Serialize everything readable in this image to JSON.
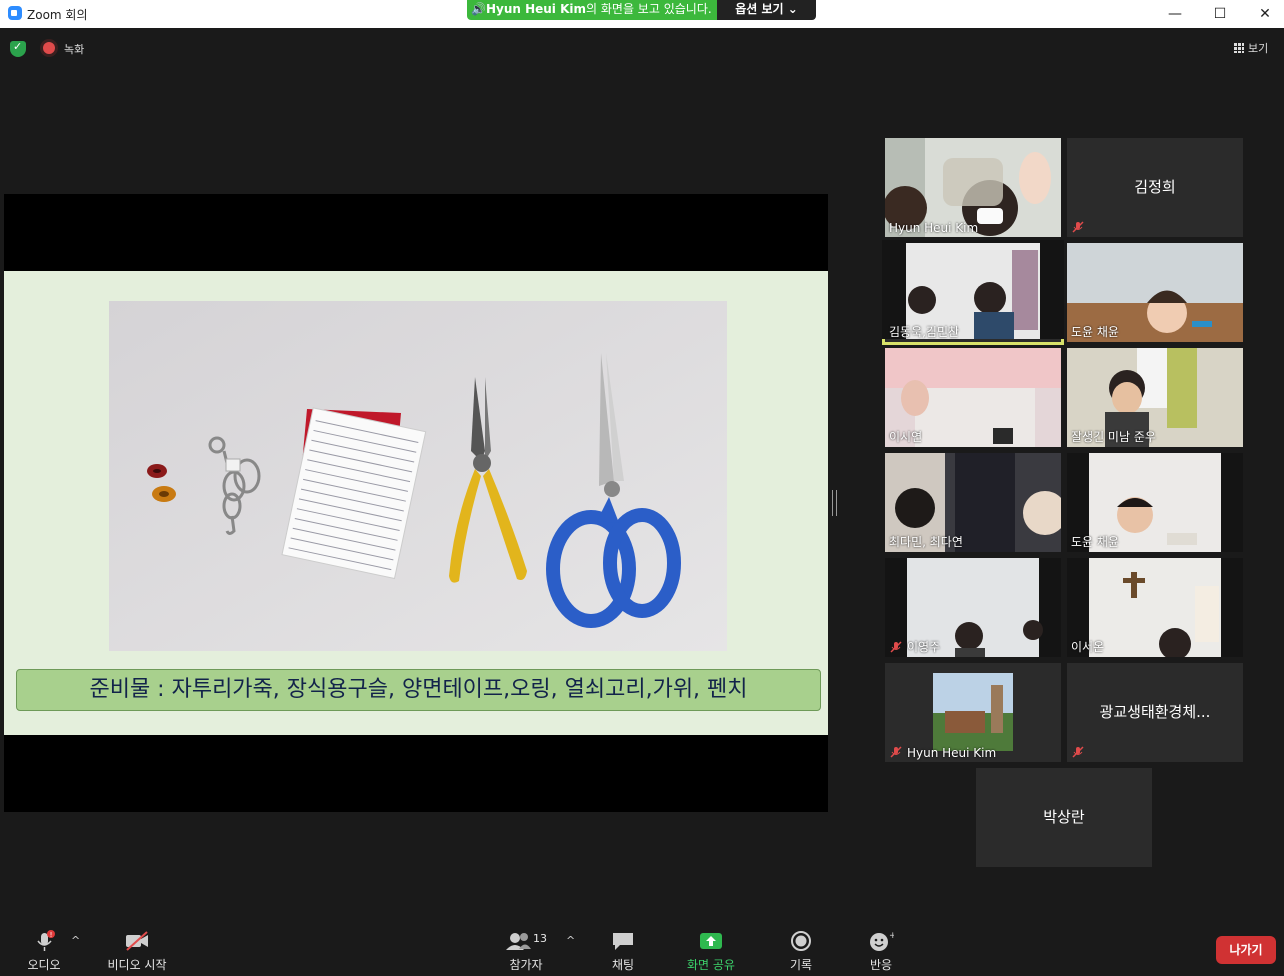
{
  "window": {
    "title": "Zoom 회의",
    "minimize": "—",
    "maximize": "☐",
    "close": "✕"
  },
  "share_banner": {
    "presenter": "Hyun Heui Kim",
    "text": "의 화면을 보고 있습니다.",
    "options_label": "옵션 보기"
  },
  "status": {
    "recording_label": "녹화",
    "view_label": "보기"
  },
  "slide": {
    "caption": "준비물 : 자투리가죽, 장식용구슬, 양면테이프,오링, 열쇠고리,가위, 펜치"
  },
  "participants": [
    {
      "name": "Hyun Heui Kim",
      "video": true,
      "muted": false,
      "speaking": false
    },
    {
      "name": "김정희",
      "video": false,
      "muted": true
    },
    {
      "name": "김동욱,김민찬",
      "video": true,
      "muted": false,
      "speaking": true
    },
    {
      "name": "도윤 채윤",
      "video": true,
      "muted": false
    },
    {
      "name": "이시연",
      "video": true,
      "muted": false
    },
    {
      "name": "잘생긴 미남 준우",
      "video": true,
      "muted": false
    },
    {
      "name": "최다민, 최다연",
      "video": true,
      "muted": false
    },
    {
      "name": "도윤 채윤",
      "video": true,
      "muted": false
    },
    {
      "name": "이영주",
      "video": true,
      "muted": true
    },
    {
      "name": "이서온",
      "video": true,
      "muted": false
    },
    {
      "name": "Hyun Heui Kim",
      "video": true,
      "muted": true
    },
    {
      "name": "광교생태환경체...",
      "video": false,
      "muted": true
    },
    {
      "name": "박상란",
      "video": false,
      "muted": false
    }
  ],
  "toolbar": {
    "audio": "오디오",
    "video": "비디오 시작",
    "participants": "참가자",
    "participants_count": "13",
    "chat": "채팅",
    "share": "화면 공유",
    "record": "기록",
    "reactions": "반응",
    "leave": "나가기"
  },
  "colors": {
    "share_banner": "#3cb83c",
    "active_speaker": "#d8e26a",
    "leave": "#d03233",
    "share_button": "#3cd06a",
    "caption_bg": "#a8d08d"
  }
}
